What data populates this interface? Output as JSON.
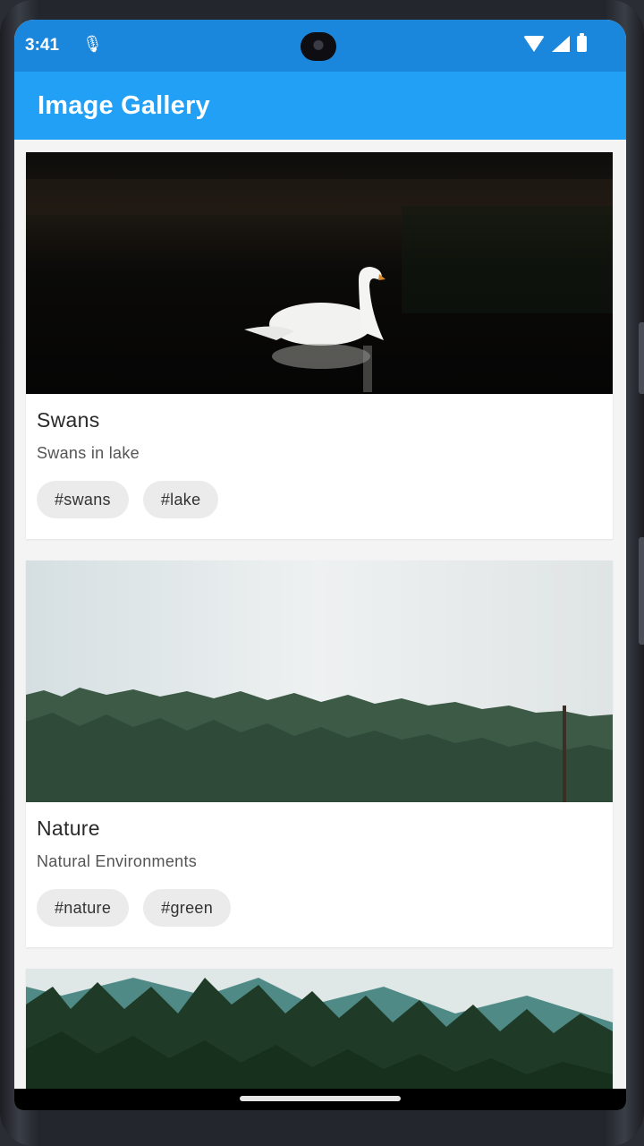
{
  "status_bar": {
    "time": "3:41",
    "mic_icon": "mic-icon",
    "wifi_icon": "wifi-icon",
    "signal_icon": "signal-icon",
    "battery_icon": "battery-icon"
  },
  "app_bar": {
    "title": "Image Gallery",
    "color": "#22a0f5"
  },
  "cards": [
    {
      "title": "Swans",
      "subtitle": "Swans in lake",
      "tags": [
        "#swans",
        "#lake"
      ]
    },
    {
      "title": "Nature",
      "subtitle": "Natural Environments",
      "tags": [
        "#nature",
        "#green"
      ]
    },
    {
      "title": "",
      "subtitle": "",
      "tags": []
    }
  ]
}
